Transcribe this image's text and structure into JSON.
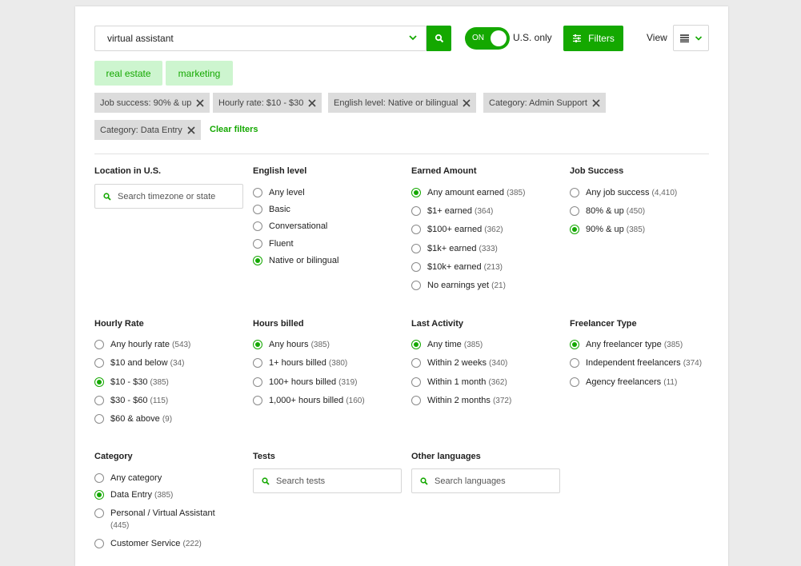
{
  "search": {
    "value": "virtual assistant"
  },
  "toggle": {
    "label": "ON",
    "us_only": "U.S. only"
  },
  "filters_label": "Filters",
  "view_label": "View",
  "skills": [
    "real estate",
    "marketing"
  ],
  "chips": [
    "Job success: 90% & up",
    "Hourly rate: $10 - $30",
    "English level: Native or bilingual",
    "Category: Admin Support",
    "Category: Data Entry"
  ],
  "clear_filters": "Clear filters",
  "location": {
    "title": "Location in U.S.",
    "placeholder": "Search timezone or state"
  },
  "english": {
    "title": "English level",
    "options": [
      {
        "label": "Any level",
        "count": "",
        "selected": false
      },
      {
        "label": "Basic",
        "count": "",
        "selected": false
      },
      {
        "label": "Conversational",
        "count": "",
        "selected": false
      },
      {
        "label": "Fluent",
        "count": "",
        "selected": false
      },
      {
        "label": "Native or bilingual",
        "count": "",
        "selected": true
      }
    ]
  },
  "earned": {
    "title": "Earned Amount",
    "options": [
      {
        "label": "Any amount earned",
        "count": "(385)",
        "selected": true
      },
      {
        "label": "$1+ earned",
        "count": "(364)",
        "selected": false
      },
      {
        "label": "$100+ earned",
        "count": "(362)",
        "selected": false
      },
      {
        "label": "$1k+ earned",
        "count": "(333)",
        "selected": false
      },
      {
        "label": "$10k+ earned",
        "count": "(213)",
        "selected": false
      },
      {
        "label": "No earnings yet",
        "count": "(21)",
        "selected": false
      }
    ]
  },
  "job_success": {
    "title": "Job Success",
    "options": [
      {
        "label": "Any job success",
        "count": "(4,410)",
        "selected": false
      },
      {
        "label": "80% & up",
        "count": "(450)",
        "selected": false
      },
      {
        "label": "90% & up",
        "count": "(385)",
        "selected": true
      }
    ]
  },
  "hourly": {
    "title": "Hourly Rate",
    "options": [
      {
        "label": "Any hourly rate",
        "count": "(543)",
        "selected": false
      },
      {
        "label": "$10 and below",
        "count": "(34)",
        "selected": false
      },
      {
        "label": "$10 - $30",
        "count": "(385)",
        "selected": true
      },
      {
        "label": "$30 - $60",
        "count": "(115)",
        "selected": false
      },
      {
        "label": "$60 & above",
        "count": "(9)",
        "selected": false
      }
    ]
  },
  "hours_billed": {
    "title": "Hours billed",
    "options": [
      {
        "label": "Any hours",
        "count": "(385)",
        "selected": true
      },
      {
        "label": "1+ hours billed",
        "count": "(380)",
        "selected": false
      },
      {
        "label": "100+ hours billed",
        "count": "(319)",
        "selected": false
      },
      {
        "label": "1,000+ hours billed",
        "count": "(160)",
        "selected": false
      }
    ]
  },
  "last_activity": {
    "title": "Last Activity",
    "options": [
      {
        "label": "Any time",
        "count": "(385)",
        "selected": true
      },
      {
        "label": "Within 2 weeks",
        "count": "(340)",
        "selected": false
      },
      {
        "label": "Within 1 month",
        "count": "(362)",
        "selected": false
      },
      {
        "label": "Within 2 months",
        "count": "(372)",
        "selected": false
      }
    ]
  },
  "freelancer_type": {
    "title": "Freelancer Type",
    "options": [
      {
        "label": "Any freelancer type",
        "count": "(385)",
        "selected": true
      },
      {
        "label": "Independent freelancers",
        "count": "(374)",
        "selected": false
      },
      {
        "label": "Agency freelancers",
        "count": "(11)",
        "selected": false
      }
    ]
  },
  "category": {
    "title": "Category",
    "options": [
      {
        "label": "Any category",
        "count": "",
        "selected": false
      },
      {
        "label": "Data Entry",
        "count": "(385)",
        "selected": true
      },
      {
        "label": "Personal / Virtual Assistant",
        "count": "(445)",
        "selected": false
      },
      {
        "label": "Customer Service",
        "count": "(222)",
        "selected": false
      }
    ]
  },
  "tests": {
    "title": "Tests",
    "placeholder": "Search tests"
  },
  "languages": {
    "title": "Other languages",
    "placeholder": "Search languages"
  }
}
